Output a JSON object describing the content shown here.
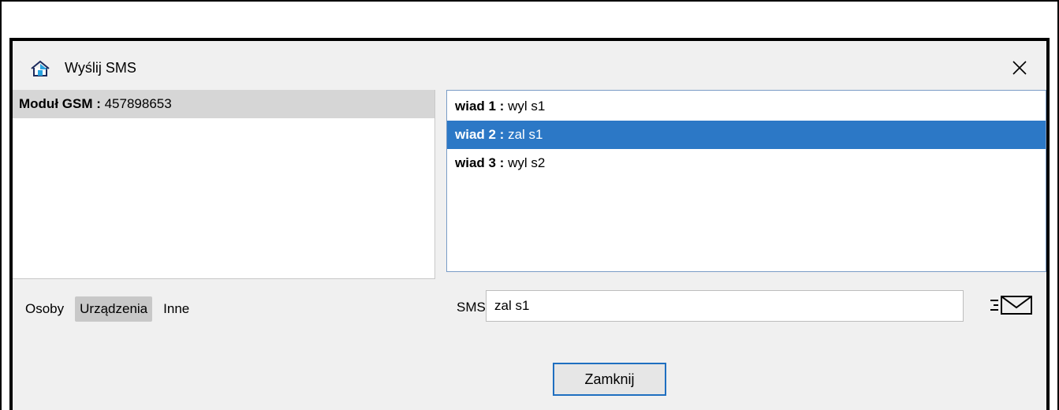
{
  "dialog": {
    "title": "Wyślij SMS",
    "icon": "home-icon",
    "close_icon": "close-icon"
  },
  "left_list": {
    "items": [
      {
        "label": "Moduł GSM : ",
        "value": "457898653"
      }
    ]
  },
  "messages": {
    "items": [
      {
        "label": "wiad 1 : ",
        "text": "wyl s1",
        "selected": false
      },
      {
        "label": "wiad 2 : ",
        "text": "zal s1",
        "selected": true
      },
      {
        "label": "wiad 3 : ",
        "text": "wyl s2",
        "selected": false
      }
    ]
  },
  "tabs": [
    {
      "label": "Osoby",
      "active": false
    },
    {
      "label": "Urządzenia",
      "active": true
    },
    {
      "label": "Inne",
      "active": false
    }
  ],
  "sms": {
    "label": "SMS",
    "value": "zal s1",
    "send_icon": "send-mail-icon"
  },
  "buttons": {
    "close_label": "Zamknij"
  },
  "colors": {
    "selection": "#2c78c6",
    "accent": "#1f6fc0",
    "icon_blue": "#29a3e0"
  }
}
